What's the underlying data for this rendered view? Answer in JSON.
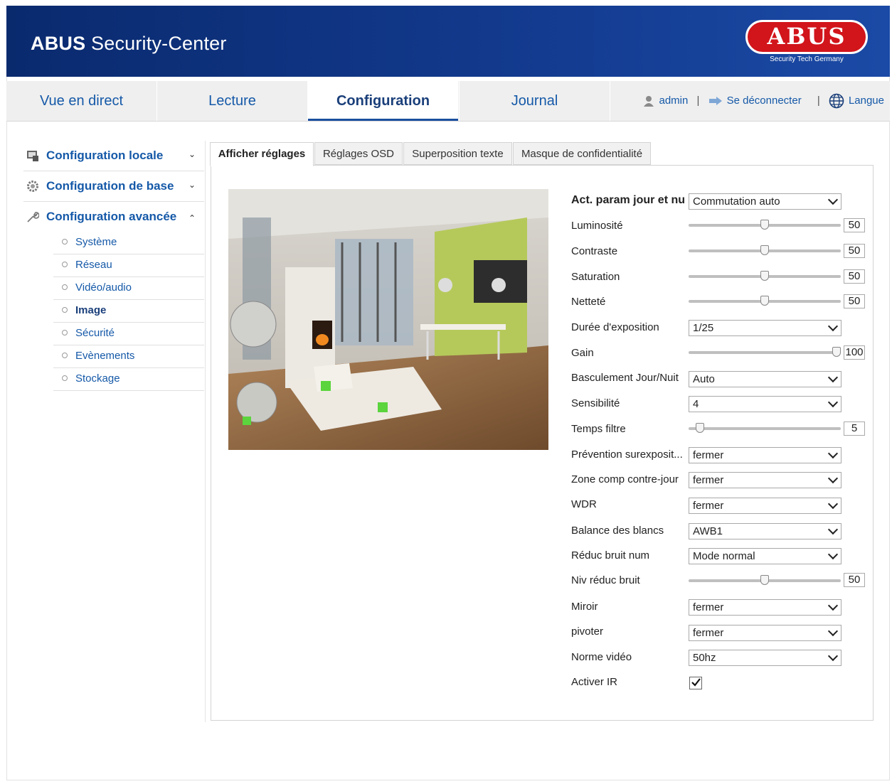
{
  "header": {
    "title_bold": "ABUS",
    "title_rest": " Security-Center",
    "logo_text": "ABUS",
    "logo_subtitle": "Security Tech Germany"
  },
  "nav": {
    "tabs": [
      {
        "label": "Vue en direct"
      },
      {
        "label": "Lecture"
      },
      {
        "label": "Configuration",
        "active": true
      },
      {
        "label": "Journal"
      }
    ],
    "user": "admin",
    "logout": "Se déconnecter",
    "language": "Langue",
    "separator": "|"
  },
  "sidebar": {
    "sections": [
      {
        "label": "Configuration locale",
        "icon": "monitor-icon",
        "state": "collapsed"
      },
      {
        "label": "Configuration de base",
        "icon": "gear-icon",
        "state": "collapsed"
      },
      {
        "label": "Configuration avancée",
        "icon": "wrench-icon",
        "state": "expanded"
      }
    ],
    "items": [
      {
        "label": "Système"
      },
      {
        "label": "Réseau"
      },
      {
        "label": "Vidéo/audio"
      },
      {
        "label": "Image",
        "active": true
      },
      {
        "label": "Sécurité"
      },
      {
        "label": "Evènements"
      },
      {
        "label": "Stockage"
      }
    ]
  },
  "subtabs": [
    {
      "label": "Afficher réglages",
      "active": true
    },
    {
      "label": "Réglages OSD"
    },
    {
      "label": "Superposition texte"
    },
    {
      "label": "Masque de confidentialité"
    }
  ],
  "form": {
    "day_night_label": "Act. param jour et nu",
    "day_night_value": "Commutation auto",
    "brightness_label": "Luminosité",
    "brightness": "50",
    "contrast_label": "Contraste",
    "contrast": "50",
    "saturation_label": "Saturation",
    "saturation": "50",
    "sharpness_label": "Netteté",
    "sharpness": "50",
    "exposure_label": "Durée d'exposition",
    "exposure": "1/25",
    "gain_label": "Gain",
    "gain": "100",
    "daynight_switch_label": "Basculement Jour/Nuit",
    "daynight_switch": "Auto",
    "sensitivity_label": "Sensibilité",
    "sensitivity": "4",
    "filter_time_label": "Temps filtre",
    "filter_time": "5",
    "overexposure_label": "Prévention surexposit...",
    "overexposure": "fermer",
    "blc_label": "Zone comp contre-jour",
    "blc": "fermer",
    "wdr_label": "WDR",
    "wdr": "fermer",
    "white_balance_label": "Balance des blancs",
    "white_balance": "AWB1",
    "dnr_label": "Réduc bruit num",
    "dnr": "Mode normal",
    "dnr_level_label": "Niv réduc bruit",
    "dnr_level": "50",
    "mirror_label": "Miroir",
    "mirror": "fermer",
    "rotate_label": "pivoter",
    "rotate": "fermer",
    "video_standard_label": "Norme vidéo",
    "video_standard": "50hz",
    "ir_label": "Activer IR",
    "ir_enabled": true
  },
  "slider_levels": {
    "brightness": 0.5,
    "contrast": 0.5,
    "saturation": 0.5,
    "sharpness": 0.5,
    "gain": 1.0,
    "filter_time": 0.05,
    "dnr_level": 0.5
  },
  "colors": {
    "header_blue": "#12398c",
    "link_blue": "#1559a8",
    "logo_red": "#d2141b"
  }
}
